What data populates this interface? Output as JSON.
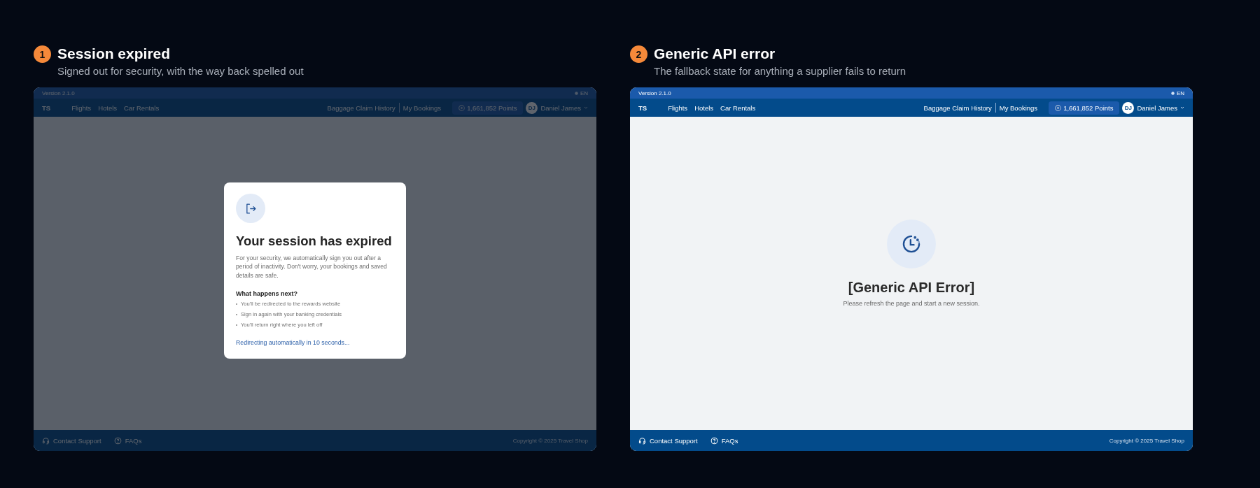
{
  "panels": [
    {
      "number": "1",
      "title": "Session expired",
      "subtitle": "Signed out for security, with the way back spelled out",
      "app": {
        "version": "Version 2.1.0",
        "language": "EN",
        "logo": "TS",
        "nav_links": [
          "Flights",
          "Hotels",
          "Car Rentals"
        ],
        "user_links": [
          "Baggage Claim History",
          "My Bookings"
        ],
        "points": "1,661,852 Points",
        "avatar": "DJ",
        "user_name": "Daniel James",
        "footer_links": [
          {
            "label": "Contact Support",
            "kind": "support"
          },
          {
            "label": "FAQs",
            "kind": "faq"
          }
        ],
        "copyright": "Copyright © 2025 Travel Shop",
        "dimmed": true
      },
      "content": {
        "kind": "session_modal",
        "title": "Your session has expired",
        "body": "For your security, we automatically sign you out after a period of inactivity. Don't worry, your bookings and saved details are safe.",
        "list_title": "What happens next?",
        "steps": [
          "You'll be redirected to the rewards website",
          "Sign in again with your banking credentials",
          "You'll return right where you left off"
        ],
        "redirect_note": "Redirecting automatically in 10 seconds..."
      }
    },
    {
      "number": "2",
      "title": "Generic API error",
      "subtitle": "The fallback state for anything a supplier fails to return",
      "app": {
        "version": "Version 2.1.0",
        "language": "EN",
        "logo": "TS",
        "nav_links": [
          "Flights",
          "Hotels",
          "Car Rentals"
        ],
        "user_links": [
          "Baggage Claim History",
          "My Bookings"
        ],
        "points": "1,661,852 Points",
        "avatar": "DJ",
        "user_name": "Daniel James",
        "footer_links": [
          {
            "label": "Contact Support",
            "kind": "support"
          },
          {
            "label": "FAQs",
            "kind": "faq"
          }
        ],
        "copyright": "Copyright © 2025 Travel Shop",
        "dimmed": false
      },
      "content": {
        "kind": "error_state",
        "title": "[Generic API Error]",
        "message": "Please refresh the page and start a new session."
      }
    }
  ]
}
